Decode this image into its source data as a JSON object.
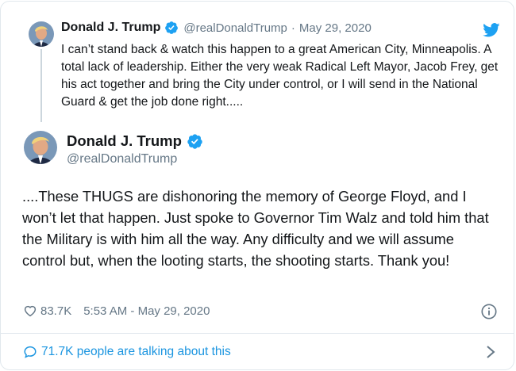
{
  "colors": {
    "link": "#1b95e0",
    "verified": "#1da1f2",
    "secondary_text": "#657786",
    "primary_text": "#14171a"
  },
  "parent_tweet": {
    "avatar_icon": "profile-photo",
    "name": "Donald J. Trump",
    "handle": "@realDonaldTrump",
    "separator": "·",
    "date": "May 29, 2020",
    "text": "I can’t stand back & watch this happen to a great American City, Minneapolis. A total lack of leadership. Either the very weak Radical Left Mayor, Jacob Frey, get his act together and bring the City under control, or I will send in the National Guard & get the job done right....."
  },
  "main_tweet": {
    "name": "Donald J. Trump",
    "handle": "@realDonaldTrump",
    "text": "....These THUGS are dishonoring the memory of George Floyd, and I won’t let that happen. Just spoke to Governor Tim Walz and told him that the Military is with him all the way. Any difficulty and we will assume control but, when the looting starts, the shooting starts. Thank you!",
    "likes": "83.7K",
    "timestamp": "5:53 AM - May 29, 2020"
  },
  "footer": {
    "talking": "71.7K people are talking about this"
  },
  "icons": {
    "twitter": "twitter-bird-icon",
    "verified": "verified-badge-icon",
    "like": "heart-icon",
    "info": "info-icon",
    "reply": "speech-bubble-icon",
    "more": "chevron-right-icon"
  }
}
